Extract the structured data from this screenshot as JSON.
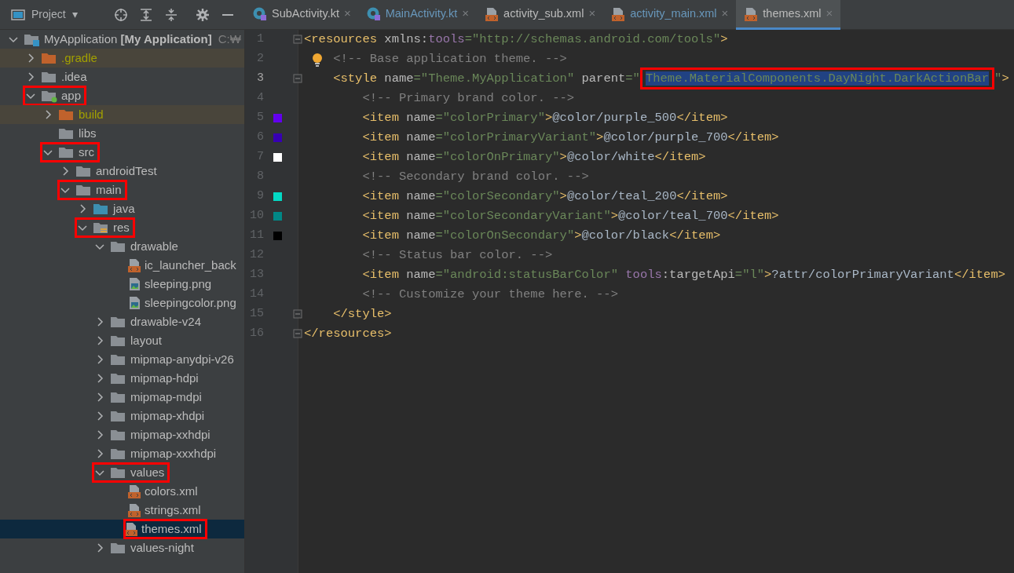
{
  "project_toolbar": {
    "title": "Project",
    "caret": "▾"
  },
  "tabs": [
    {
      "label": "SubActivity.kt",
      "kind": "kotlin",
      "selected": false,
      "modified": false,
      "close": "×"
    },
    {
      "label": "MainActivity.kt",
      "kind": "kotlin",
      "selected": false,
      "modified": true,
      "close": "×"
    },
    {
      "label": "activity_sub.xml",
      "kind": "xml",
      "selected": false,
      "modified": false,
      "close": "×"
    },
    {
      "label": "activity_main.xml",
      "kind": "xml",
      "selected": false,
      "modified": true,
      "close": "×"
    },
    {
      "label": "themes.xml",
      "kind": "xml",
      "selected": true,
      "modified": false,
      "close": "×"
    }
  ],
  "tree": [
    {
      "label": "MyApplication **[My Application]**",
      "path": "C:₩",
      "kind": "project",
      "expanded": true,
      "selected": false,
      "highlighted": false,
      "children": [
        {
          "label": ".gradle",
          "kind": "excluded",
          "expanded": false,
          "selected": false,
          "highlighted": false
        },
        {
          "label": ".idea",
          "kind": "folder",
          "expanded": false,
          "selected": false,
          "highlighted": false
        },
        {
          "label": "app",
          "kind": "module",
          "expanded": true,
          "selected": false,
          "highlighted": true,
          "children": [
            {
              "label": "build",
              "kind": "excluded",
              "expanded": false,
              "selected": false,
              "highlighted": false
            },
            {
              "label": "libs",
              "kind": "folder",
              "selected": false,
              "highlighted": false
            },
            {
              "label": "src",
              "kind": "folder",
              "expanded": true,
              "selected": false,
              "highlighted": true,
              "children": [
                {
                  "label": "androidTest",
                  "kind": "folder",
                  "expanded": false,
                  "selected": false,
                  "highlighted": false
                },
                {
                  "label": "main",
                  "kind": "folder",
                  "expanded": true,
                  "selected": false,
                  "highlighted": true,
                  "children": [
                    {
                      "label": "java",
                      "kind": "source",
                      "expanded": false,
                      "selected": false,
                      "highlighted": false
                    },
                    {
                      "label": "res",
                      "kind": "res",
                      "expanded": true,
                      "selected": false,
                      "highlighted": true,
                      "children": [
                        {
                          "label": "drawable",
                          "kind": "folder",
                          "expanded": true,
                          "selected": false,
                          "highlighted": false,
                          "children": [
                            {
                              "label": "ic_launcher_back",
                              "kind": "xml",
                              "selected": false,
                              "highlighted": false
                            },
                            {
                              "label": "sleeping.png",
                              "kind": "image",
                              "selected": false,
                              "highlighted": false
                            },
                            {
                              "label": "sleepingcolor.png",
                              "kind": "image",
                              "selected": false,
                              "highlighted": false
                            }
                          ]
                        },
                        {
                          "label": "drawable-v24",
                          "kind": "folder",
                          "expanded": false,
                          "selected": false,
                          "highlighted": false
                        },
                        {
                          "label": "layout",
                          "kind": "folder",
                          "expanded": false,
                          "selected": false,
                          "highlighted": false
                        },
                        {
                          "label": "mipmap-anydpi-v26",
                          "kind": "folder",
                          "expanded": false,
                          "selected": false,
                          "highlighted": false
                        },
                        {
                          "label": "mipmap-hdpi",
                          "kind": "folder",
                          "expanded": false,
                          "selected": false,
                          "highlighted": false
                        },
                        {
                          "label": "mipmap-mdpi",
                          "kind": "folder",
                          "expanded": false,
                          "selected": false,
                          "highlighted": false
                        },
                        {
                          "label": "mipmap-xhdpi",
                          "kind": "folder",
                          "expanded": false,
                          "selected": false,
                          "highlighted": false
                        },
                        {
                          "label": "mipmap-xxhdpi",
                          "kind": "folder",
                          "expanded": false,
                          "selected": false,
                          "highlighted": false
                        },
                        {
                          "label": "mipmap-xxxhdpi",
                          "kind": "folder",
                          "expanded": false,
                          "selected": false,
                          "highlighted": false
                        },
                        {
                          "label": "values",
                          "kind": "folder",
                          "expanded": true,
                          "selected": false,
                          "highlighted": true,
                          "children": [
                            {
                              "label": "colors.xml",
                              "kind": "xml",
                              "selected": false,
                              "highlighted": false
                            },
                            {
                              "label": "strings.xml",
                              "kind": "xml",
                              "selected": false,
                              "highlighted": false
                            },
                            {
                              "label": "themes.xml",
                              "kind": "xml",
                              "selected": true,
                              "highlighted": true
                            }
                          ]
                        },
                        {
                          "label": "values-night",
                          "kind": "folder",
                          "expanded": false,
                          "selected": false,
                          "highlighted": false
                        }
                      ]
                    }
                  ]
                }
              ]
            }
          ]
        }
      ]
    }
  ],
  "code_lines": [
    {
      "number": "1",
      "fold": true,
      "current": false,
      "bulb": false,
      "tokens": [
        {
          "kind": "tag",
          "s": "<resources "
        },
        {
          "kind": "attr",
          "s": "xmlns:"
        },
        {
          "kind": "ns",
          "s": "tools"
        },
        {
          "kind": "value",
          "s": "=\"http://schemas.android.com/tools\""
        },
        {
          "kind": "tag",
          "s": ">"
        }
      ]
    },
    {
      "number": "2",
      "fold": false,
      "current": false,
      "bulb": true,
      "tokens": [
        {
          "kind": "comment",
          "s": "    <!-- Base application theme. -->"
        }
      ]
    },
    {
      "number": "3",
      "fold": true,
      "current": true,
      "bulb": false,
      "tokens": [
        {
          "kind": "tag",
          "s": "    <style "
        },
        {
          "kind": "attr",
          "s": "name"
        },
        {
          "kind": "value",
          "s": "=\"Theme.MyApplication\" "
        },
        {
          "kind": "attr",
          "s": "parent"
        },
        {
          "kind": "value",
          "s": "=\""
        },
        {
          "kind": "value",
          "s": "Theme.MaterialComponents.DayNight.DarkActionBar",
          "selected": true,
          "boxed": true
        },
        {
          "kind": "value",
          "s": "\""
        },
        {
          "kind": "tag",
          "s": ">"
        }
      ]
    },
    {
      "number": "4",
      "fold": false,
      "current": false,
      "bulb": false,
      "tokens": [
        {
          "kind": "comment",
          "s": "        <!-- Primary brand color. -->"
        }
      ]
    },
    {
      "number": "5",
      "fold": false,
      "current": false,
      "bulb": false,
      "color": "#6200ee",
      "tokens": [
        {
          "kind": "tag",
          "s": "        <item "
        },
        {
          "kind": "attr",
          "s": "name"
        },
        {
          "kind": "value",
          "s": "=\"colorPrimary\""
        },
        {
          "kind": "tag",
          "s": ">"
        },
        {
          "kind": "text",
          "s": "@color/purple_500"
        },
        {
          "kind": "tag",
          "s": "</item>"
        }
      ]
    },
    {
      "number": "6",
      "fold": false,
      "current": false,
      "bulb": false,
      "color": "#3700b3",
      "tokens": [
        {
          "kind": "tag",
          "s": "        <item "
        },
        {
          "kind": "attr",
          "s": "name"
        },
        {
          "kind": "value",
          "s": "=\"colorPrimaryVariant\""
        },
        {
          "kind": "tag",
          "s": ">"
        },
        {
          "kind": "text",
          "s": "@color/purple_700"
        },
        {
          "kind": "tag",
          "s": "</item>"
        }
      ]
    },
    {
      "number": "7",
      "fold": false,
      "current": false,
      "bulb": false,
      "color": "#ffffff",
      "tokens": [
        {
          "kind": "tag",
          "s": "        <item "
        },
        {
          "kind": "attr",
          "s": "name"
        },
        {
          "kind": "value",
          "s": "=\"colorOnPrimary\""
        },
        {
          "kind": "tag",
          "s": ">"
        },
        {
          "kind": "text",
          "s": "@color/white"
        },
        {
          "kind": "tag",
          "s": "</item>"
        }
      ]
    },
    {
      "number": "8",
      "fold": false,
      "current": false,
      "bulb": false,
      "tokens": [
        {
          "kind": "comment",
          "s": "        <!-- Secondary brand color. -->"
        }
      ]
    },
    {
      "number": "9",
      "fold": false,
      "current": false,
      "bulb": false,
      "color": "#03dac5",
      "tokens": [
        {
          "kind": "tag",
          "s": "        <item "
        },
        {
          "kind": "attr",
          "s": "name"
        },
        {
          "kind": "value",
          "s": "=\"colorSecondary\""
        },
        {
          "kind": "tag",
          "s": ">"
        },
        {
          "kind": "text",
          "s": "@color/teal_200"
        },
        {
          "kind": "tag",
          "s": "</item>"
        }
      ]
    },
    {
      "number": "10",
      "fold": false,
      "current": false,
      "bulb": false,
      "color": "#018786",
      "tokens": [
        {
          "kind": "tag",
          "s": "        <item "
        },
        {
          "kind": "attr",
          "s": "name"
        },
        {
          "kind": "value",
          "s": "=\"colorSecondaryVariant\""
        },
        {
          "kind": "tag",
          "s": ">"
        },
        {
          "kind": "text",
          "s": "@color/teal_700"
        },
        {
          "kind": "tag",
          "s": "</item>"
        }
      ]
    },
    {
      "number": "11",
      "fold": false,
      "current": false,
      "bulb": false,
      "color": "#000000",
      "tokens": [
        {
          "kind": "tag",
          "s": "        <item "
        },
        {
          "kind": "attr",
          "s": "name"
        },
        {
          "kind": "value",
          "s": "=\"colorOnSecondary\""
        },
        {
          "kind": "tag",
          "s": ">"
        },
        {
          "kind": "text",
          "s": "@color/black"
        },
        {
          "kind": "tag",
          "s": "</item>"
        }
      ]
    },
    {
      "number": "12",
      "fold": false,
      "current": false,
      "bulb": false,
      "tokens": [
        {
          "kind": "comment",
          "s": "        <!-- Status bar color. -->"
        }
      ]
    },
    {
      "number": "13",
      "fold": false,
      "current": false,
      "bulb": false,
      "tokens": [
        {
          "kind": "tag",
          "s": "        <item "
        },
        {
          "kind": "attr",
          "s": "name"
        },
        {
          "kind": "value",
          "s": "=\"android:statusBarColor\" "
        },
        {
          "kind": "ns",
          "s": "tools"
        },
        {
          "kind": "attr",
          "s": ":targetApi"
        },
        {
          "kind": "value",
          "s": "=\"l\""
        },
        {
          "kind": "tag",
          "s": ">"
        },
        {
          "kind": "text",
          "s": "?attr/colorPrimaryVariant"
        },
        {
          "kind": "tag",
          "s": "</item>"
        }
      ]
    },
    {
      "number": "14",
      "fold": false,
      "current": false,
      "bulb": false,
      "tokens": [
        {
          "kind": "comment",
          "s": "        <!-- Customize your theme here. -->"
        }
      ]
    },
    {
      "number": "15",
      "fold": true,
      "current": false,
      "bulb": false,
      "tokens": [
        {
          "kind": "tag",
          "s": "    </style>"
        }
      ]
    },
    {
      "number": "16",
      "fold": true,
      "current": false,
      "bulb": false,
      "tokens": [
        {
          "kind": "tag",
          "s": "</resources>"
        }
      ]
    }
  ]
}
